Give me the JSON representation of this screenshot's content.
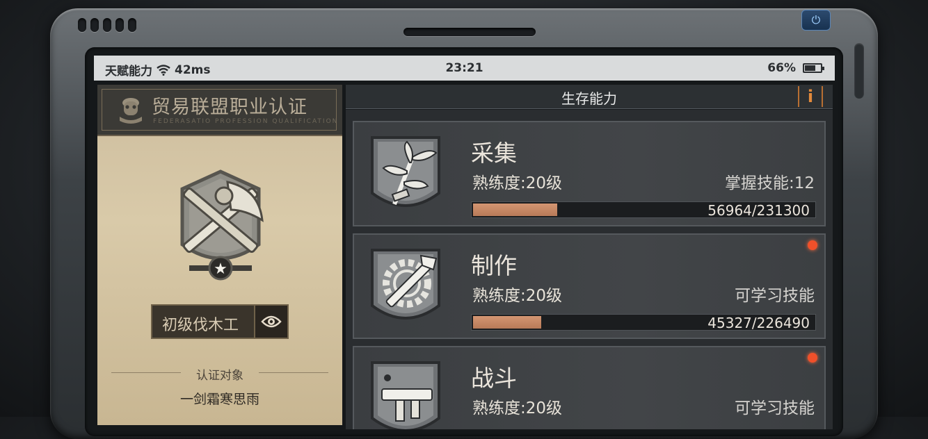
{
  "status_bar": {
    "left_label": "天赋能力",
    "ping": "42ms",
    "time": "23:21",
    "battery_percent": "66%",
    "battery_level": 0.66
  },
  "certification": {
    "title": "贸易联盟职业认证",
    "subtitle": "FEDERASATIO PROFESSION QUALIFICATION",
    "rank": "初级伐木工",
    "target_label": "认证对象",
    "target_name": "一剑霜寒思雨"
  },
  "panel": {
    "title": "生存能力",
    "info_label": "i"
  },
  "skills": [
    {
      "name": "采集",
      "proficiency": "熟练度:20级",
      "extra": "掌握技能:12",
      "progress_text": "56964/231300",
      "progress": 56964,
      "progress_max": 231300,
      "has_notification": false,
      "icon": "plant-icon"
    },
    {
      "name": "制作",
      "proficiency": "熟练度:20级",
      "extra": "可学习技能",
      "progress_text": "45327/226490",
      "progress": 45327,
      "progress_max": 226490,
      "has_notification": true,
      "icon": "hammer-gear-icon"
    },
    {
      "name": "战斗",
      "proficiency": "熟练度:20级",
      "extra": "可学习技能",
      "progress_text": "",
      "has_notification": true,
      "icon": "gun-icon"
    }
  ],
  "colors": {
    "accent_orange": "#e28a3c",
    "progress_fill": "#c98a66",
    "notification_red": "#f0502a"
  }
}
